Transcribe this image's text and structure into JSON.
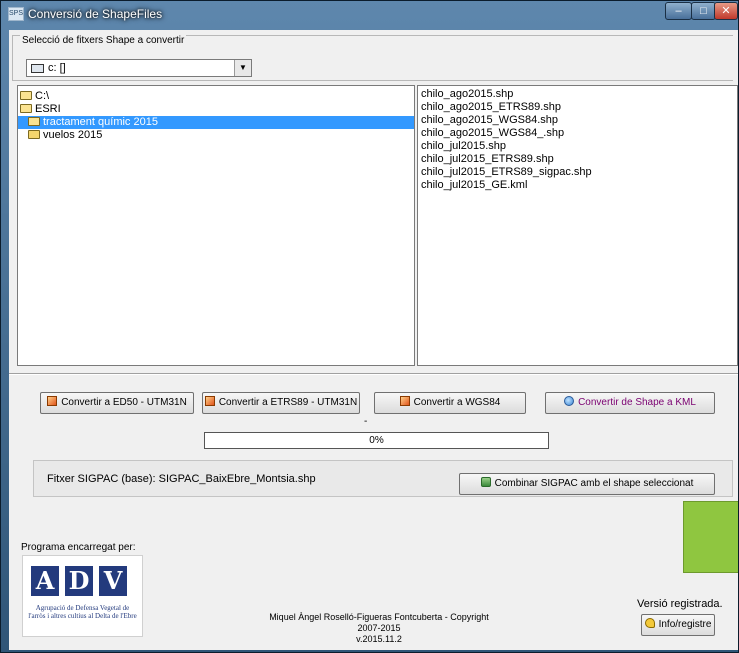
{
  "window": {
    "title": "Conversió de ShapeFiles",
    "icon_text": "SPS",
    "controls": {
      "minimize": "–",
      "maximize": "□",
      "close": "✕"
    }
  },
  "selection": {
    "group_label": "Selecció de fitxers Shape a convertir",
    "drive": "c: []"
  },
  "tree": [
    {
      "label": "C:\\",
      "indent": 0,
      "icon": "folder-open",
      "selected": false
    },
    {
      "label": "ESRI",
      "indent": 0,
      "icon": "folder-open",
      "selected": false
    },
    {
      "label": "tractament químic 2015",
      "indent": 1,
      "icon": "folder-open",
      "selected": true
    },
    {
      "label": "vuelos 2015",
      "indent": 1,
      "icon": "folder-closed",
      "selected": false
    }
  ],
  "files": [
    "chilo_ago2015.shp",
    "chilo_ago2015_ETRS89.shp",
    "chilo_ago2015_WGS84.shp",
    "chilo_ago2015_WGS84_.shp",
    "chilo_jul2015.shp",
    "chilo_jul2015_ETRS89.shp",
    "chilo_jul2015_ETRS89_sigpac.shp",
    "chilo_jul2015_GE.kml"
  ],
  "buttons": {
    "ed50": "Convertir a ED50 - UTM31N",
    "etrs89": "Convertir a ETRS89 - UTM31N",
    "wgs84": "Convertir a WGS84",
    "kml": "Convertir de  Shape a KML",
    "combine": "Combinar SIGPAC amb el shape seleccionat",
    "info": "Info/registre"
  },
  "progress": {
    "dash": "-",
    "value": 0,
    "label": "0%"
  },
  "sigpac": {
    "text": "Fitxer SIGPAC (base):  SIGPAC_BaixEbre_Montsia.shp"
  },
  "footer": {
    "program_label": "Programa encarregat per:",
    "logo_letters": [
      "A",
      "D",
      "V"
    ],
    "logo_caption": "Agrupació de Defensa Vegetal de l'arròs i altres cultius al Delta de l'Ebre",
    "copyright": "Miquel Àngel Roselló-Figueras Fontcuberta - Copyright 2007-2015",
    "version": "v.2015.11.2",
    "registered": "Versió registrada."
  },
  "colors": {
    "accent_green": "#8fc640",
    "selection": "#3399ff",
    "logo_blue": "#233a7d",
    "kml_text": "#7a0070"
  }
}
